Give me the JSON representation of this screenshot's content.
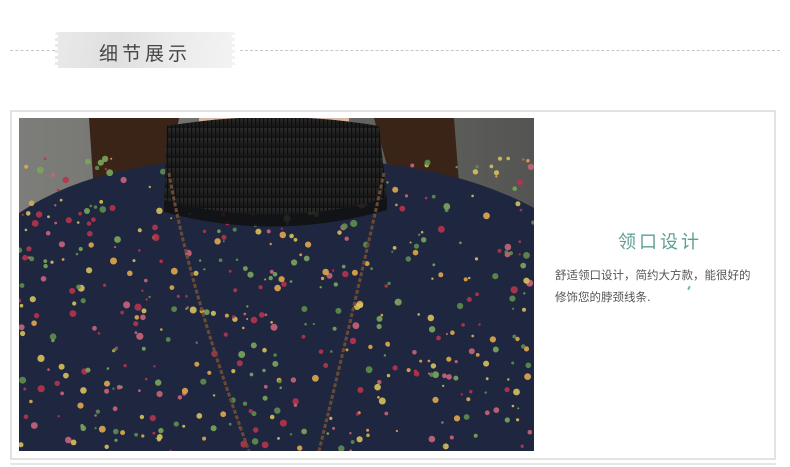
{
  "section": {
    "title": "细节展示"
  },
  "detail": {
    "title": "领口设计",
    "description_line1": "舒适领口设计，简约大方款，能很好的",
    "description_line2": "修饰您的脖颈线条."
  },
  "photo": {
    "subject": "floral-print-turtleneck-top"
  },
  "colors": {
    "accent": "#5e9e94",
    "fabric_base": "#1f2740",
    "collar": "#1c1c1c",
    "text": "#555555"
  }
}
